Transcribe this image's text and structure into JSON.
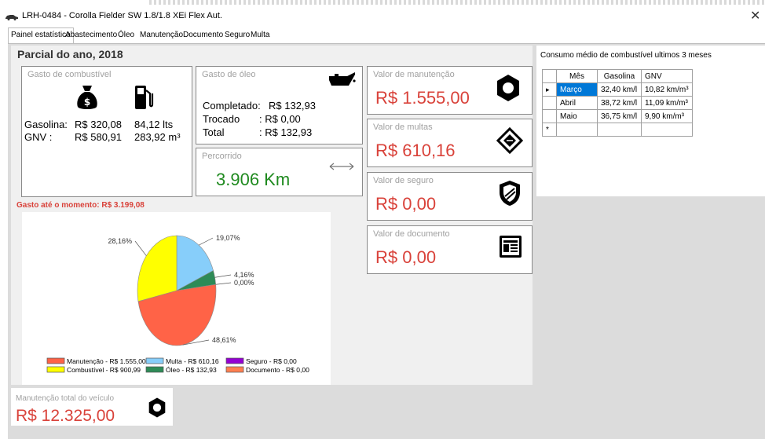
{
  "window": {
    "title": "LRH-0484 - Corolla Fielder SW 1.8/1.8 XEi Flex Aut.",
    "close_glyph": "✕"
  },
  "tabs": [
    "Painel estatístico",
    "Abastecimento",
    "Óleo",
    "Manutenção",
    "Documento",
    "Seguro",
    "Multa"
  ],
  "partial": {
    "title": "Parcial do ano, 2018"
  },
  "fuel": {
    "label": "Gasto de combustível",
    "gasoline_label": "Gasolina:",
    "gasoline_value": "R$ 320,08",
    "gasoline_volume": "84,12 lts",
    "gnv_label": "GNV :",
    "gnv_value": "R$ 580,91",
    "gnv_volume": "283,92 m³"
  },
  "oil": {
    "label": "Gasto de óleo",
    "completed_label": "Completado:",
    "completed_value": "R$ 132,93",
    "changed_label": "Trocado",
    "changed_value": ": R$ 0,00",
    "total_label": "Total",
    "total_value": ": R$ 132,93"
  },
  "distance": {
    "label": "Percorrido",
    "value": "3.906 Km"
  },
  "maintenance": {
    "label": "Valor de manutenção",
    "value": "R$ 1.555,00"
  },
  "fines": {
    "label": "Valor de multas",
    "value": "R$ 610,16"
  },
  "insurance": {
    "label": "Valor de seguro",
    "value": "R$ 0,00"
  },
  "document": {
    "label": "Valor de documento",
    "value": "R$ 0,00"
  },
  "spent_so_far": "Gasto até o momento: R$ 3.199,08",
  "chart_data": {
    "type": "pie",
    "slices": [
      {
        "name": "Multa - R$ 610,16",
        "value": 610.16,
        "label": "19,07%",
        "color": "#87cefa"
      },
      {
        "name": "Óleo - R$ 132,93",
        "value": 132.93,
        "label": "4,16%",
        "color": "#2e8b57"
      },
      {
        "name": "Documento - R$ 0,00",
        "value": 0,
        "label": "0,00%",
        "color": "#ff7f50"
      },
      {
        "name": "Manutenção - R$ 1.555,00",
        "value": 1555.0,
        "label": "48,61%",
        "color": "#ff6347"
      },
      {
        "name": "Combustível - R$ 900,99",
        "value": 900.99,
        "label": "28,16%",
        "color": "#ffff00"
      },
      {
        "name": "Seguro - R$ 0,00",
        "value": 0,
        "label": "",
        "color": "#9400d3"
      }
    ]
  },
  "consumption": {
    "title": "Consumo médio de combustível ultimos 3 meses",
    "headers": [
      "Mês",
      "Gasolina",
      "GNV"
    ],
    "rows": [
      [
        "Março",
        "32,40 km/l",
        "10,82 km/m³"
      ],
      [
        "Abril",
        "38,72 km/l",
        "11,09 km/m³"
      ],
      [
        "Maio",
        "36,75 km/l",
        "9,90 km/m³"
      ]
    ],
    "current_marker": "▸",
    "new_row_marker": "*"
  },
  "total_maintenance": {
    "label": "Manutenção total do veículo",
    "value": "R$ 12.325,00"
  }
}
